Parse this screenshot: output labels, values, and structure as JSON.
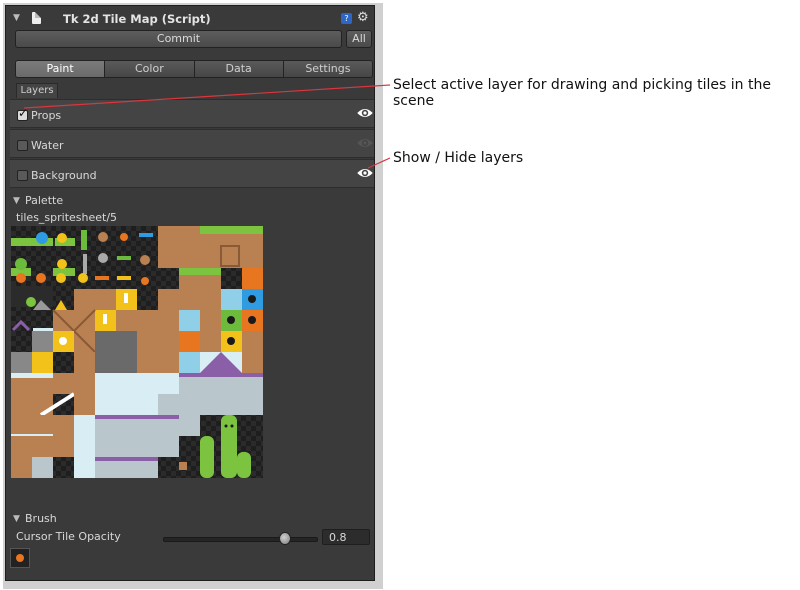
{
  "window": {
    "title": "Tk 2d Tile Map (Script)",
    "help_icon": "help-icon",
    "gear_icon": "gear-icon"
  },
  "toolbar": {
    "commit_label": "Commit",
    "all_label": "All"
  },
  "tabs": [
    {
      "label": "Paint",
      "active": true
    },
    {
      "label": "Color",
      "active": false
    },
    {
      "label": "Data",
      "active": false
    },
    {
      "label": "Settings",
      "active": false
    }
  ],
  "layers": {
    "header": "Layers",
    "items": [
      {
        "name": "Props",
        "checked": true,
        "visible": true
      },
      {
        "name": "Water",
        "checked": false,
        "visible": false
      },
      {
        "name": "Background",
        "checked": false,
        "visible": true
      }
    ]
  },
  "palette": {
    "title": "Palette",
    "sheet_name": "tiles_spritesheet/5"
  },
  "brush": {
    "title": "Brush",
    "cursor_opacity_label": "Cursor Tile Opacity",
    "cursor_opacity_value": "0.8",
    "cursor_opacity_fraction": 0.8
  },
  "annotations": [
    {
      "text": "Select active layer for drawing and picking tiles in the scene"
    },
    {
      "text": "Show / Hide layers"
    }
  ],
  "colors": {
    "panel_bg": "#3a3a3a",
    "callout_line": "#d9363e",
    "dirt": "#b98052",
    "grass": "#7cc43f",
    "snow": "#d9eef4",
    "water": "#8fd0e8",
    "purple": "#8a5fa8",
    "lock_yellow": "#f2c21b",
    "lock_blue": "#2f9be0",
    "lock_orange": "#e8751f",
    "lock_green": "#6dbb3c"
  }
}
